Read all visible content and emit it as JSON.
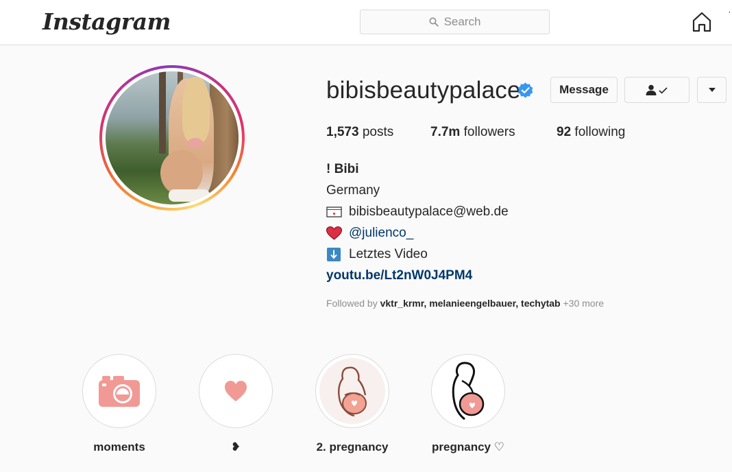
{
  "nav": {
    "logo_text": "Instagram",
    "search_placeholder": "Search",
    "home_icon": "home-icon"
  },
  "profile": {
    "username": "bibisbeautypalace",
    "verified": true,
    "accent_color": "#3897f0",
    "buttons": {
      "message_label": "Message",
      "following_icon": "person-check-icon",
      "more_icon": "caret-down-icon"
    },
    "stats": {
      "posts_count": "1,573",
      "posts_label": "posts",
      "followers_count": "7.7m",
      "followers_label": "followers",
      "following_count": "92",
      "following_label": "following"
    },
    "bio": {
      "name": "! Bibi",
      "location": "Germany",
      "email_icon": "envelope-icon",
      "email": "bibisbeautypalace@web.de",
      "heart_icon": "red-heart-icon",
      "mention": "@julienco_",
      "arrow_icon": "down-arrow-icon",
      "video_text": "Letztes Video",
      "link": "youtu.be/Lt2nW0J4PM4"
    },
    "followed_by": {
      "prefix": "Followed by",
      "names": "vktr_krmr, melanieengelbauer, techytab",
      "more": "+30 more"
    }
  },
  "highlights": [
    {
      "label": "moments",
      "icon": "camera-icon"
    },
    {
      "label": "❥",
      "icon": "heart-icon"
    },
    {
      "label": "2. pregnancy",
      "icon": "pregnant-woman-icon"
    },
    {
      "label": "pregnancy ♡",
      "icon": "pregnant-silhouette-icon"
    }
  ]
}
